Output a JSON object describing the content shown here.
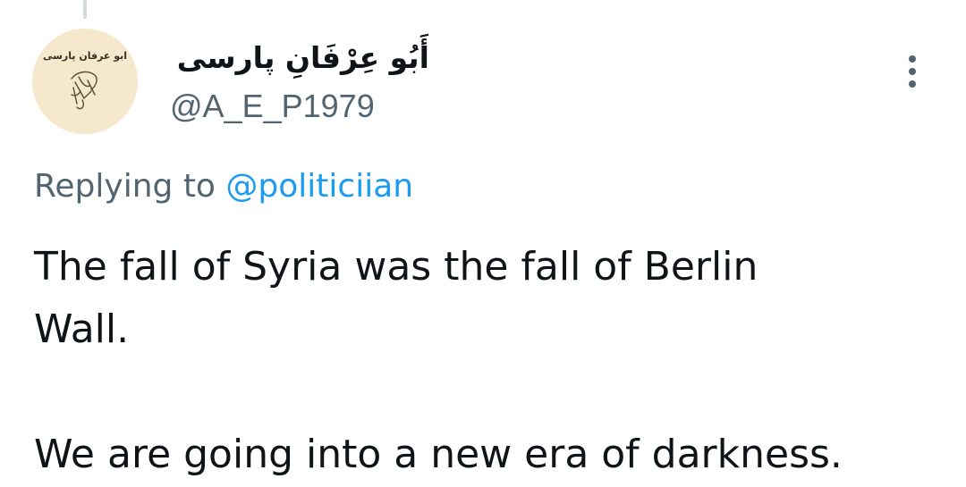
{
  "author": {
    "display_name": "أَبُو عِرْفَانِ پارسی",
    "handle": "@A_E_P1979",
    "avatar_text": "ابو عرفان پارسی"
  },
  "reply": {
    "prefix": "Replying to",
    "mention": "@politiciian"
  },
  "tweet": {
    "paragraph_1_line_1": "The fall of Syria was the fall of Berlin",
    "paragraph_1_line_2": "Wall.",
    "paragraph_2": "We are going into a new era of darkness."
  },
  "colors": {
    "text_primary": "#0f1419",
    "text_secondary": "#536471",
    "link": "#1d9bf0",
    "avatar_bg": "#f6e8cd",
    "thread_line": "#cfd9de"
  },
  "icons": {
    "more": "more-vertical-icon"
  }
}
